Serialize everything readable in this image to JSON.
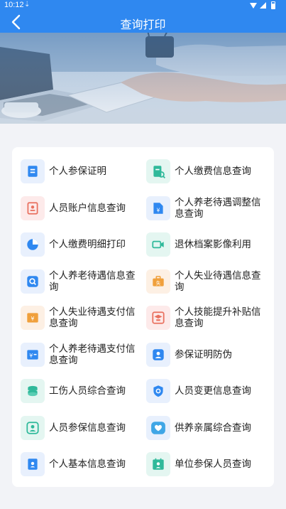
{
  "status_bar": {
    "time": "10:12",
    "download_icon": "download-icon"
  },
  "header": {
    "title": "查询打印",
    "back_icon": "chevron-left-icon",
    "color": "#2f88f0"
  },
  "menu": {
    "items": [
      {
        "label": "个人参保证明",
        "icon": "certificate-icon",
        "tint": "blue"
      },
      {
        "label": "个人缴费信息查询",
        "icon": "document-search-icon",
        "tint": "green"
      },
      {
        "label": "人员账户信息查询",
        "icon": "account-document-icon",
        "tint": "red"
      },
      {
        "label": "个人养老待遇调整信息查询",
        "icon": "yen-document-icon",
        "tint": "blue"
      },
      {
        "label": "个人缴费明细打印",
        "icon": "pie-chart-icon",
        "tint": "blue"
      },
      {
        "label": "退休档案影像利用",
        "icon": "video-camera-icon",
        "tint": "green"
      },
      {
        "label": "个人养老待遇信息查询",
        "icon": "search-icon",
        "tint": "blue"
      },
      {
        "label": "个人失业待遇信息查询",
        "icon": "briefcase-icon",
        "tint": "orange"
      },
      {
        "label": "个人失业待遇支付信息查询",
        "icon": "yen-ticket-icon",
        "tint": "orange"
      },
      {
        "label": "个人技能提升补贴信息查询",
        "icon": "graduation-cap-icon",
        "tint": "red"
      },
      {
        "label": "个人养老待遇支付信息查询",
        "icon": "yen-card-icon",
        "tint": "blue"
      },
      {
        "label": "参保证明防伪",
        "icon": "user-badge-icon",
        "tint": "blue"
      },
      {
        "label": "工伤人员综合查询",
        "icon": "coins-icon",
        "tint": "green"
      },
      {
        "label": "人员变更信息查询",
        "icon": "shield-icon",
        "tint": "blue"
      },
      {
        "label": "人员参保信息查询",
        "icon": "person-circle-icon",
        "tint": "green"
      },
      {
        "label": "供养亲属综合查询",
        "icon": "heart-map-icon",
        "tint": "blue"
      },
      {
        "label": "个人基本信息查询",
        "icon": "contact-card-icon",
        "tint": "blue"
      },
      {
        "label": "单位参保人员查询",
        "icon": "calendar-person-icon",
        "tint": "green"
      }
    ]
  }
}
